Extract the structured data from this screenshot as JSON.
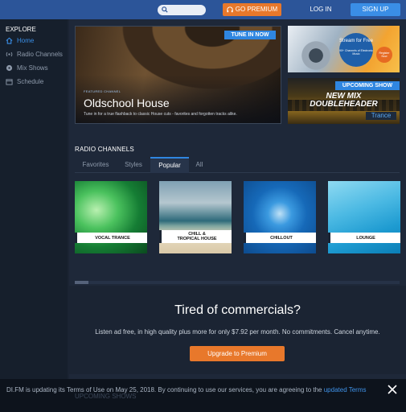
{
  "topbar": {
    "premium_label": "GO PREMIUM",
    "login_label": "LOG IN",
    "signup_label": "SIGN UP"
  },
  "sidebar": {
    "heading": "EXPLORE",
    "items": [
      {
        "label": "Home",
        "icon": "home-icon",
        "active": true
      },
      {
        "label": "Radio Channels",
        "icon": "radio-icon"
      },
      {
        "label": "Mix Shows",
        "icon": "vinyl-icon"
      },
      {
        "label": "Schedule",
        "icon": "calendar-icon"
      }
    ]
  },
  "hero": {
    "tag": "TUNE IN NOW",
    "kicker": "FEATURED CHANNEL",
    "title": "Oldschool House",
    "description": "Tune in for a true flashback to classic House cuts - favorites and forgotten tracks alike."
  },
  "promo_stream": {
    "line1": "Stream for Free",
    "line2": "90+ Channels of Electronic Music",
    "badge": "Register Now"
  },
  "promo_upcoming": {
    "tag": "UPCOMING SHOW",
    "line1": "NEW MIX",
    "line2": "DOUBLEHEADER",
    "channel": "Trance"
  },
  "radio_channels": {
    "title": "RADIO CHANNELS",
    "tabs": [
      "Favorites",
      "Styles",
      "Popular",
      "All"
    ],
    "active_tab": "Popular",
    "tiles": [
      {
        "line1": "VOCAL TRANCE",
        "line2": ""
      },
      {
        "line1": "CHILL &",
        "line2": "TROPICAL HOUSE"
      },
      {
        "line1": "CHILLOUT",
        "line2": ""
      },
      {
        "line1": "LOUNGE",
        "line2": ""
      }
    ]
  },
  "upsell": {
    "title": "Tired of commercials?",
    "text": "Listen ad free, in high quality plus more for only $7.92 per month. No commitments. Cancel anytime.",
    "button": "Upgrade to Premium"
  },
  "cookie": {
    "text": "DI.FM is updating its Terms of Use on May 25, 2018. By continuing to use our services, you are agreeing to the ",
    "link": "updated Terms",
    "behind": "UPCOMING SHOWS"
  },
  "colors": {
    "brand_blue": "#2c5599",
    "accent_orange": "#e8782b",
    "link_blue": "#3a8ee6"
  }
}
